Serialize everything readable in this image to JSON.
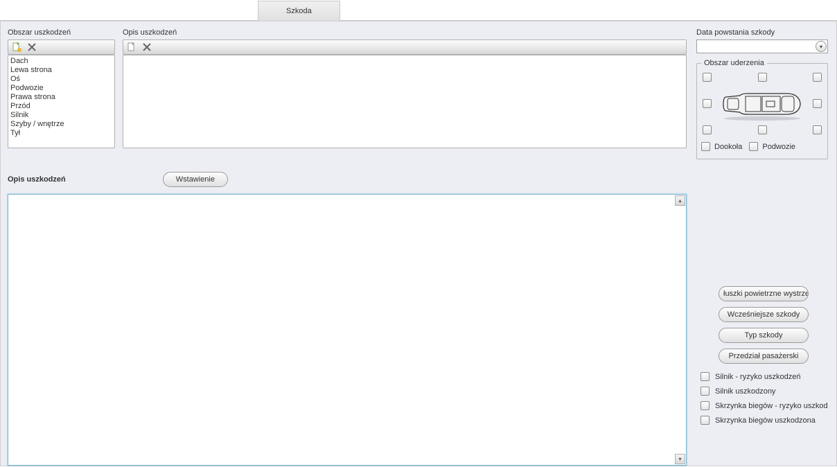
{
  "tab": {
    "label": "Szkoda"
  },
  "leftPanel": {
    "title": "Obszar uszkodzeń",
    "items": [
      "Dach",
      "Lewa strona",
      "Oś",
      "Podwozie",
      "Prawa strona",
      "Przód",
      "Silnik",
      "Szyby / wnętrze",
      "Tył"
    ]
  },
  "midPanel": {
    "title": "Opis uszkodzeń"
  },
  "bottom": {
    "title": "Opis uszkodzeń",
    "insertBtn": "Wstawienie",
    "text": ""
  },
  "right": {
    "dateLabel": "Data powstania szkody",
    "dateValue": "",
    "impactTitle": "Obszar uderzenia",
    "around": "Dookoła",
    "chassis": "Podwozie"
  },
  "buttons": {
    "airbags": "łuszki powietrzne wystrze",
    "previous": "Wcześniejsze szkody",
    "type": "Typ szkody",
    "passenger": "Przedział pasażerski"
  },
  "checks": {
    "engineRisk": "Silnik - ryzyko uszkodzeń",
    "engineDamaged": "Silnik uszkodzony",
    "gearboxRisk": "Skrzynka biegów - ryzyko uszkod",
    "gearboxDamaged": "Skrzynka biegów uszkodzona"
  }
}
